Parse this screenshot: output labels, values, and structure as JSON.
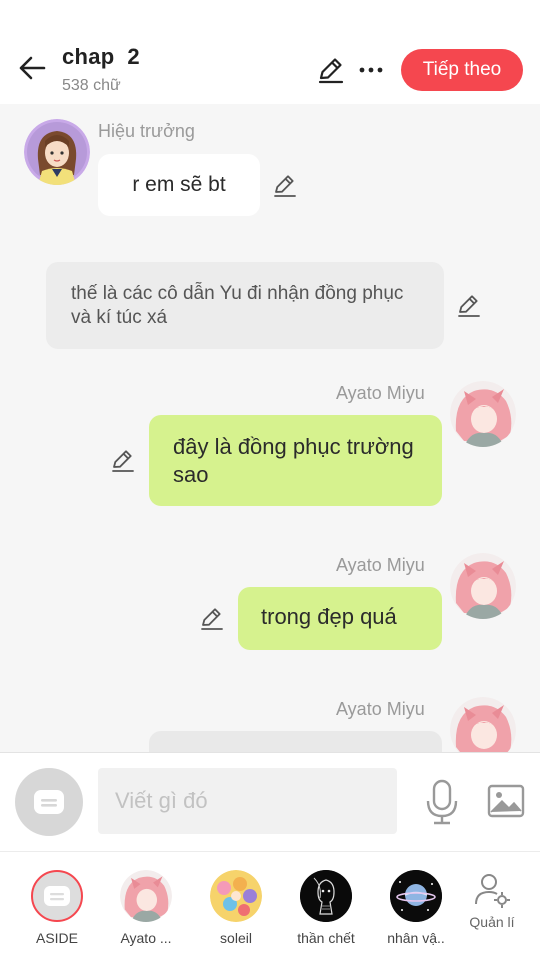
{
  "header": {
    "title": "chap  2",
    "word_count": "538 chữ",
    "next_label": "Tiếp theo"
  },
  "messages": [
    {
      "speaker": "Hiệu trưởng",
      "text": "r em sẽ bt"
    },
    {
      "text": "thế là các cô dẫn Yu đi nhận đồng phục và kí túc xá"
    },
    {
      "speaker": "Ayato  Miyu",
      "text": "đây là đồng phục trường sao"
    },
    {
      "speaker": "Ayato  Miyu",
      "text": "trong đẹp quá"
    },
    {
      "speaker": "Ayato  Miyu"
    }
  ],
  "input": {
    "placeholder": "Viết gì đó"
  },
  "characters": [
    {
      "label": "ASIDE"
    },
    {
      "label": "Ayato ..."
    },
    {
      "label": "soleil"
    },
    {
      "label": "thần chết"
    },
    {
      "label": "nhân vậ.."
    },
    {
      "label": "Quản lí"
    }
  ],
  "colors": {
    "accent": "#f5474f",
    "own_bubble": "#d6f28e",
    "narration_bubble": "#ececec"
  }
}
